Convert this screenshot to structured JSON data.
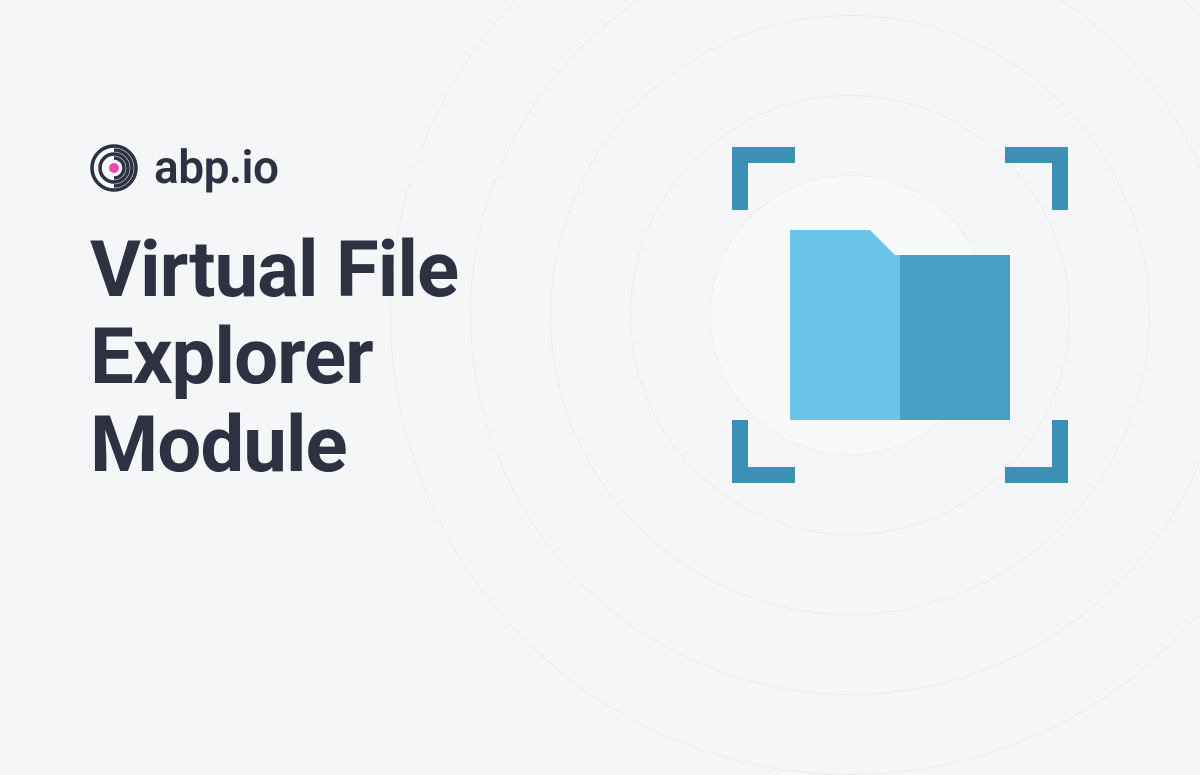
{
  "brand": {
    "name": "abp.io"
  },
  "title": {
    "line1": "Virtual File",
    "line2": "Explorer",
    "line3": "Module"
  },
  "illustration": {
    "name": "folder-scan-icon"
  },
  "colors": {
    "text": "#2d3142",
    "folderLight": "#6bc4ea",
    "folderDark": "#4a9fc4",
    "bracket": "#3d8fb5",
    "logoAccent": "#e94bae"
  }
}
